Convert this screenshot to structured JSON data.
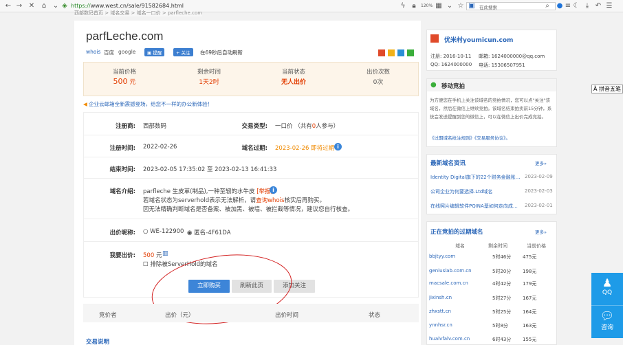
{
  "browser": {
    "url_prefix": "https://",
    "url_rest": "www.west.cn/sale/91582684.html",
    "zoom": "120%",
    "search_placeholder": "在此搜索",
    "breadcrumb": "西部数码首页 > 域名交易 > 域名一口价 > parfleche.com"
  },
  "title": "parfLeche.com",
  "tools": {
    "whois": "whois",
    "baidu": "百度",
    "google": "google",
    "remind": "提醒",
    "follow": "+ 关注",
    "refresh_note": "在69秒后自动刷新"
  },
  "stats": [
    {
      "label": "当前价格",
      "value": "500",
      "unit": "元"
    },
    {
      "label": "剩余时间",
      "value": "1天2时"
    },
    {
      "label": "当前状态",
      "value": "无人出价"
    },
    {
      "label": "出价次数",
      "value": "0次"
    }
  ],
  "notice": "企业云邮箱全新震撼登场，给您不一样的办公新体验！",
  "details": {
    "registrar_label": "注册商:",
    "registrar": "西部数码",
    "trade_type_label": "交易类型:",
    "trade_type_a": "一口价 （共有",
    "trade_type_count": "0",
    "trade_type_b": "人参与）",
    "reg_time_label": "注册时间:",
    "reg_time": "2022-02-26",
    "expire_label": "域名过期:",
    "expire": "2023-02-26 即将过期",
    "end_label": "结束时间:",
    "end_time": "2023-02-05 17:35:02 至 2023-02-13 16:41:33",
    "intro_label": "域名介绍:",
    "intro_line1": "parfleche 生皮革(制品),一种至轫的水牛皮",
    "intro_report": "[举报]",
    "intro_line2a": "若域名状态为serverhold表示无法解析，请",
    "intro_line2_link": "查询whois",
    "intro_line2b": "核实后再购买。",
    "intro_line3": "因无法精确判断域名是否备案、被加黑、被墙、被拦截等情况，建议您自行核查。",
    "nick_label": "出价昵称:",
    "nick_opt1": "WE-122900",
    "nick_opt2": "匿名-4F61DA",
    "bid_label": "我要出价:",
    "bid_value": "500",
    "bid_unit": "元",
    "exclude": "排除被ServerHold的域名",
    "buy_btn": "立即购买",
    "refresh_btn": "刷新此页",
    "follow_btn": "添加关注"
  },
  "bid_table_headers": [
    "竞价者",
    "出价（元）",
    "出价时间",
    "状态"
  ],
  "trade_note": "交易说明",
  "seller": {
    "name": "优米村youmicun.com",
    "reg_label": "注册:",
    "reg": "2016-10-11",
    "email_label": "邮箱:",
    "email": "1624000000@qq.com",
    "qq_label": "QQ:",
    "qq": "1624000000",
    "phone_label": "电话:",
    "phone": "15306507951"
  },
  "mobile_auction": {
    "title": "移动竞拍",
    "text": "为方便您在手机上关注该域名的竞拍情况，您可以点\"关注\"该域名，然后在微信上继续竞拍。该域名结束拍卖前15分钟，系统会发送提醒到您的微信上，可以在微信上出价完成竞拍。",
    "links": "《过期域名抢注规则》《交易服务协议》。"
  },
  "news": {
    "title": "最新域名资讯",
    "more": "更多»",
    "items": [
      {
        "title": "Identity Digital旗下的22个财务金融账…",
        "date": "2023-02-09"
      },
      {
        "title": "公司企业为何要选择.Ltd域名",
        "date": "2023-02-03"
      },
      {
        "title": "在线照片编辑软件PQINA基如何走向成…",
        "date": "2023-02-01"
      }
    ]
  },
  "expired": {
    "title": "正在竞拍的过期域名",
    "more": "更多»",
    "headers": [
      "域名",
      "剩余时间",
      "当前价格"
    ],
    "rows": [
      {
        "domain": "bbjtyy.com",
        "time": "5时46分",
        "price": "475元"
      },
      {
        "domain": "geniuslab.com.cn",
        "time": "5时20分",
        "price": "198元"
      },
      {
        "domain": "macsale.com.cn",
        "time": "4时42分",
        "price": "179元"
      },
      {
        "domain": "jixinsh.cn",
        "time": "5时27分",
        "price": "167元"
      },
      {
        "domain": "zhxstt.cn",
        "time": "5时25分",
        "price": "164元"
      },
      {
        "domain": "ynnhsr.cn",
        "time": "5时8分",
        "price": "163元"
      },
      {
        "domain": "hualvfalv.com.cn",
        "time": "6时43分",
        "price": "155元"
      }
    ]
  },
  "side_tag": "拼音五笔",
  "float": {
    "qq": "QQ",
    "zixun": "咨询"
  },
  "colors": {
    "accent": "#1e9be8",
    "price": "#e23c00",
    "orange": "#f08a00"
  }
}
